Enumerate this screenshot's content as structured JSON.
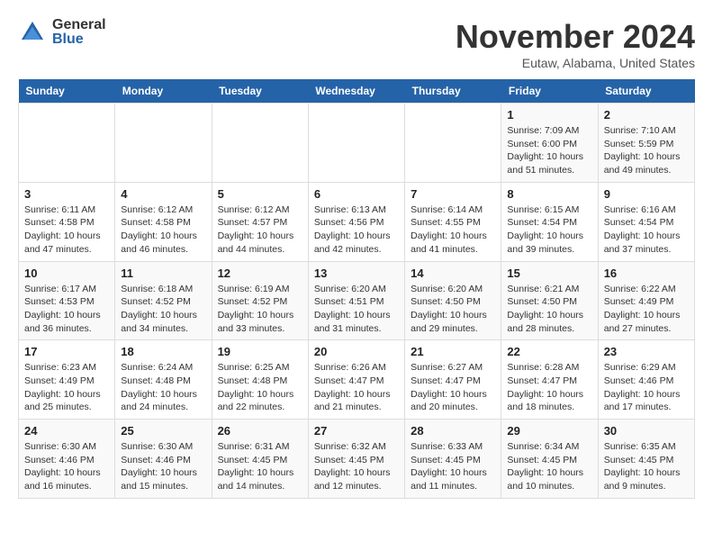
{
  "logo": {
    "general": "General",
    "blue": "Blue"
  },
  "title": "November 2024",
  "subtitle": "Eutaw, Alabama, United States",
  "days_of_week": [
    "Sunday",
    "Monday",
    "Tuesday",
    "Wednesday",
    "Thursday",
    "Friday",
    "Saturday"
  ],
  "weeks": [
    [
      {
        "day": "",
        "info": ""
      },
      {
        "day": "",
        "info": ""
      },
      {
        "day": "",
        "info": ""
      },
      {
        "day": "",
        "info": ""
      },
      {
        "day": "",
        "info": ""
      },
      {
        "day": "1",
        "info": "Sunrise: 7:09 AM\nSunset: 6:00 PM\nDaylight: 10 hours\nand 51 minutes."
      },
      {
        "day": "2",
        "info": "Sunrise: 7:10 AM\nSunset: 5:59 PM\nDaylight: 10 hours\nand 49 minutes."
      }
    ],
    [
      {
        "day": "3",
        "info": "Sunrise: 6:11 AM\nSunset: 4:58 PM\nDaylight: 10 hours\nand 47 minutes."
      },
      {
        "day": "4",
        "info": "Sunrise: 6:12 AM\nSunset: 4:58 PM\nDaylight: 10 hours\nand 46 minutes."
      },
      {
        "day": "5",
        "info": "Sunrise: 6:12 AM\nSunset: 4:57 PM\nDaylight: 10 hours\nand 44 minutes."
      },
      {
        "day": "6",
        "info": "Sunrise: 6:13 AM\nSunset: 4:56 PM\nDaylight: 10 hours\nand 42 minutes."
      },
      {
        "day": "7",
        "info": "Sunrise: 6:14 AM\nSunset: 4:55 PM\nDaylight: 10 hours\nand 41 minutes."
      },
      {
        "day": "8",
        "info": "Sunrise: 6:15 AM\nSunset: 4:54 PM\nDaylight: 10 hours\nand 39 minutes."
      },
      {
        "day": "9",
        "info": "Sunrise: 6:16 AM\nSunset: 4:54 PM\nDaylight: 10 hours\nand 37 minutes."
      }
    ],
    [
      {
        "day": "10",
        "info": "Sunrise: 6:17 AM\nSunset: 4:53 PM\nDaylight: 10 hours\nand 36 minutes."
      },
      {
        "day": "11",
        "info": "Sunrise: 6:18 AM\nSunset: 4:52 PM\nDaylight: 10 hours\nand 34 minutes."
      },
      {
        "day": "12",
        "info": "Sunrise: 6:19 AM\nSunset: 4:52 PM\nDaylight: 10 hours\nand 33 minutes."
      },
      {
        "day": "13",
        "info": "Sunrise: 6:20 AM\nSunset: 4:51 PM\nDaylight: 10 hours\nand 31 minutes."
      },
      {
        "day": "14",
        "info": "Sunrise: 6:20 AM\nSunset: 4:50 PM\nDaylight: 10 hours\nand 29 minutes."
      },
      {
        "day": "15",
        "info": "Sunrise: 6:21 AM\nSunset: 4:50 PM\nDaylight: 10 hours\nand 28 minutes."
      },
      {
        "day": "16",
        "info": "Sunrise: 6:22 AM\nSunset: 4:49 PM\nDaylight: 10 hours\nand 27 minutes."
      }
    ],
    [
      {
        "day": "17",
        "info": "Sunrise: 6:23 AM\nSunset: 4:49 PM\nDaylight: 10 hours\nand 25 minutes."
      },
      {
        "day": "18",
        "info": "Sunrise: 6:24 AM\nSunset: 4:48 PM\nDaylight: 10 hours\nand 24 minutes."
      },
      {
        "day": "19",
        "info": "Sunrise: 6:25 AM\nSunset: 4:48 PM\nDaylight: 10 hours\nand 22 minutes."
      },
      {
        "day": "20",
        "info": "Sunrise: 6:26 AM\nSunset: 4:47 PM\nDaylight: 10 hours\nand 21 minutes."
      },
      {
        "day": "21",
        "info": "Sunrise: 6:27 AM\nSunset: 4:47 PM\nDaylight: 10 hours\nand 20 minutes."
      },
      {
        "day": "22",
        "info": "Sunrise: 6:28 AM\nSunset: 4:47 PM\nDaylight: 10 hours\nand 18 minutes."
      },
      {
        "day": "23",
        "info": "Sunrise: 6:29 AM\nSunset: 4:46 PM\nDaylight: 10 hours\nand 17 minutes."
      }
    ],
    [
      {
        "day": "24",
        "info": "Sunrise: 6:30 AM\nSunset: 4:46 PM\nDaylight: 10 hours\nand 16 minutes."
      },
      {
        "day": "25",
        "info": "Sunrise: 6:30 AM\nSunset: 4:46 PM\nDaylight: 10 hours\nand 15 minutes."
      },
      {
        "day": "26",
        "info": "Sunrise: 6:31 AM\nSunset: 4:45 PM\nDaylight: 10 hours\nand 14 minutes."
      },
      {
        "day": "27",
        "info": "Sunrise: 6:32 AM\nSunset: 4:45 PM\nDaylight: 10 hours\nand 12 minutes."
      },
      {
        "day": "28",
        "info": "Sunrise: 6:33 AM\nSunset: 4:45 PM\nDaylight: 10 hours\nand 11 minutes."
      },
      {
        "day": "29",
        "info": "Sunrise: 6:34 AM\nSunset: 4:45 PM\nDaylight: 10 hours\nand 10 minutes."
      },
      {
        "day": "30",
        "info": "Sunrise: 6:35 AM\nSunset: 4:45 PM\nDaylight: 10 hours\nand 9 minutes."
      }
    ]
  ]
}
